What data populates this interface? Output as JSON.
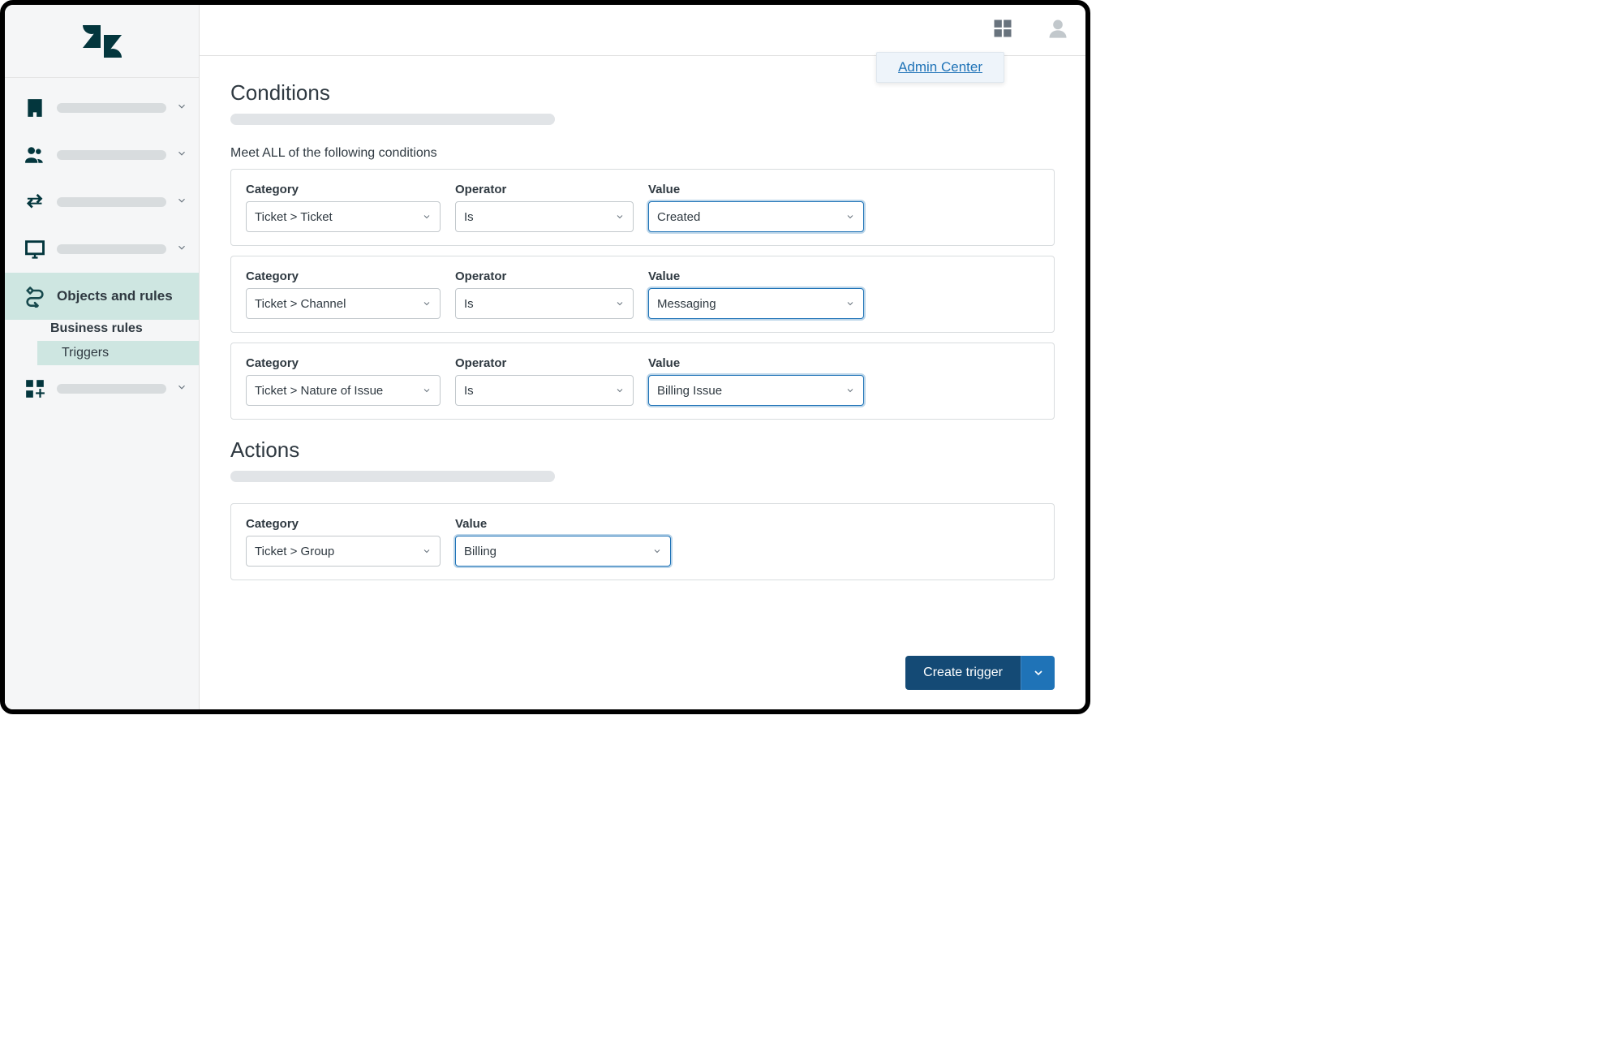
{
  "header": {
    "admin_link": "Admin Center"
  },
  "sidebar": {
    "active_label": "Objects and rules",
    "sub_parent": "Business rules",
    "sub_child": "Triggers"
  },
  "conditions": {
    "title": "Conditions",
    "group_label": "Meet ALL of the following conditions",
    "labels": {
      "category": "Category",
      "operator": "Operator",
      "value": "Value"
    },
    "rows": [
      {
        "category": "Ticket > Ticket",
        "operator": "Is",
        "value": "Created"
      },
      {
        "category": "Ticket > Channel",
        "operator": "Is",
        "value": "Messaging"
      },
      {
        "category": "Ticket > Nature of Issue",
        "operator": "Is",
        "value": "Billing Issue"
      }
    ]
  },
  "actions": {
    "title": "Actions",
    "labels": {
      "category": "Category",
      "value": "Value"
    },
    "rows": [
      {
        "category": "Ticket > Group",
        "value": "Billing"
      }
    ]
  },
  "footer": {
    "create": "Create trigger"
  }
}
